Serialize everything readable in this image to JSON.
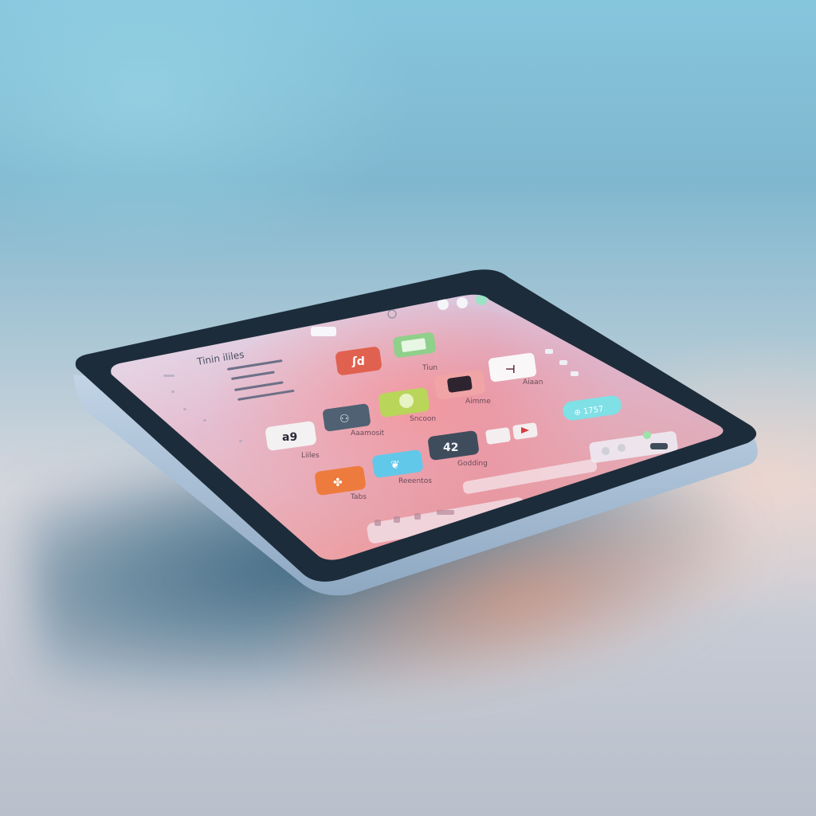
{
  "screen": {
    "title": "Tinin ililes",
    "top_right_badge": "",
    "pill_button_label": "⊕ 1757",
    "icon_42_glyph": "42",
    "icon_a9_glyph": "a9"
  },
  "apps": [
    {
      "name": "calendar-app",
      "glyph": "ʃd",
      "color": "#e0614f",
      "label": ""
    },
    {
      "name": "photos-app",
      "glyph": "▦",
      "color": "#8fd08a",
      "label": "Tiun"
    },
    {
      "name": "calculator-app",
      "glyph": "a9",
      "color": "#f4f1f3",
      "label": "Liiles"
    },
    {
      "name": "chat-app",
      "glyph": "⚇",
      "color": "#4f6173",
      "label": "Aaamosit"
    },
    {
      "name": "phone-app",
      "glyph": "✆",
      "color": "#b9d55a",
      "label": "Sncoon"
    },
    {
      "name": "camera-app",
      "glyph": "▣",
      "color": "#f0a4a6",
      "label": "Aimme"
    },
    {
      "name": "pin-app",
      "glyph": "⊣",
      "color": "#faf7f8",
      "label": "Aiaan"
    },
    {
      "name": "fan-app",
      "glyph": "✤",
      "color": "#ee7b3e",
      "label": "Tabs"
    },
    {
      "name": "twitter-app",
      "glyph": "❦",
      "color": "#62c8ea",
      "label": "Reeentos"
    },
    {
      "name": "clock-app",
      "glyph": "42",
      "color": "#3f4c5c",
      "label": "Godding"
    },
    {
      "name": "youtube-app",
      "glyph": "▶",
      "color": "#f4eef0",
      "label": ""
    }
  ],
  "colors": {
    "bezel": "#1c2c3a",
    "frame": "#a9c2da",
    "screen_top": "#c9c8e4",
    "screen_bottom": "#e98f96",
    "pill": "#7fe0e6"
  }
}
